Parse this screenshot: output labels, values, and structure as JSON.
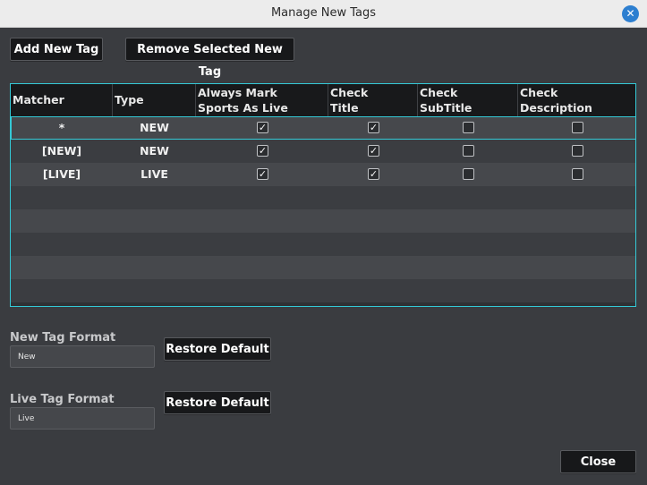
{
  "window": {
    "title": "Manage New Tags"
  },
  "toolbar": {
    "add_label": "Add New Tag",
    "remove_label": "Remove Selected New Tag"
  },
  "table": {
    "headers": [
      {
        "line1": "Matcher",
        "line2": ""
      },
      {
        "line1": "Type",
        "line2": ""
      },
      {
        "line1": "Always Mark",
        "line2": "Sports As Live"
      },
      {
        "line1": "Check",
        "line2": "Title"
      },
      {
        "line1": "Check",
        "line2": "SubTitle"
      },
      {
        "line1": "Check",
        "line2": "Description"
      }
    ],
    "rows": [
      {
        "matcher": "*",
        "type": "NEW",
        "sports_live": true,
        "check_title": true,
        "check_subtitle": false,
        "check_description": false
      },
      {
        "matcher": "[NEW]",
        "type": "NEW",
        "sports_live": true,
        "check_title": true,
        "check_subtitle": false,
        "check_description": false
      },
      {
        "matcher": "[LIVE]",
        "type": "LIVE",
        "sports_live": true,
        "check_title": true,
        "check_subtitle": false,
        "check_description": false
      }
    ],
    "checkmark": "✓"
  },
  "new_tag": {
    "label": "New Tag Format",
    "value": "New",
    "restore_label": "Restore Default"
  },
  "live_tag": {
    "label": "Live Tag Format",
    "value": "Live",
    "restore_label": "Restore Default"
  },
  "footer": {
    "close_label": "Close"
  },
  "colors": {
    "accent": "#34c9d6",
    "button_bg": "#17181a",
    "dialog_bg": "#3a3c40"
  },
  "icons": {
    "window_close": "close-icon",
    "checkbox": "checkbox"
  }
}
